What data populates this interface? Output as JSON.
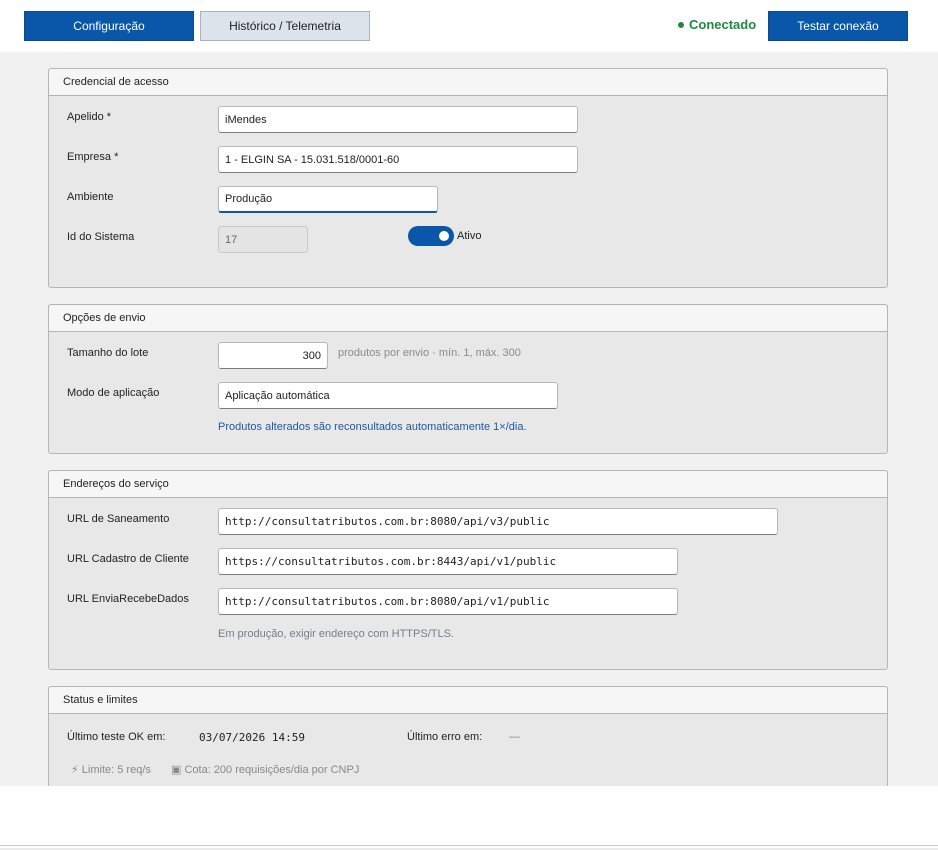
{
  "topbar": {
    "tab_config": "Configuração",
    "tab_history": "Histórico / Telemetria",
    "status": "Conectado",
    "test_button": "Testar conexão"
  },
  "credential": {
    "title": "Credencial de acesso",
    "nickname_label": "Apelido *",
    "nickname_value": "iMendes",
    "company_label": "Empresa *",
    "company_value": "1 - ELGIN SA - 15.031.518/0001-60",
    "environment_label": "Ambiente",
    "environment_value": "Produção",
    "system_id_label": "Id do Sistema",
    "system_id_value": "17",
    "active_label": "Ativo"
  },
  "send_options": {
    "title": "Opções de envio",
    "batch_label": "Tamanho do lote",
    "batch_value": "300",
    "batch_hint": "produtos por envio · mín. 1, máx. 300",
    "mode_label": "Modo de aplicação",
    "mode_value": "Aplicação automática",
    "mode_hint": "Produtos alterados são reconsultados automaticamente 1×/dia."
  },
  "endpoints": {
    "title": "Endereços do serviço",
    "sanitize_label": "URL de Saneamento",
    "sanitize_value": "http://consultatributos.com.br:8080/api/v3/public",
    "customer_label": "URL Cadastro de Cliente",
    "customer_value": "https://consultatributos.com.br:8443/api/v1/public",
    "sendrecv_label": "URL EnviaRecebeDados",
    "sendrecv_value": "http://consultatributos.com.br:8080/api/v1/public",
    "hint": "Em produção, exigir endereço com HTTPS/TLS."
  },
  "status": {
    "title": "Status e limites",
    "last_ok_label": "Último teste OK em:",
    "last_ok_value": "03/07/2026 14:59",
    "last_error_label": "Último erro em:",
    "last_error_value": "—",
    "limit_text": "Limite: 5 req/s",
    "quota_text": "Cota: 200 requisições/dia por CNPJ"
  }
}
